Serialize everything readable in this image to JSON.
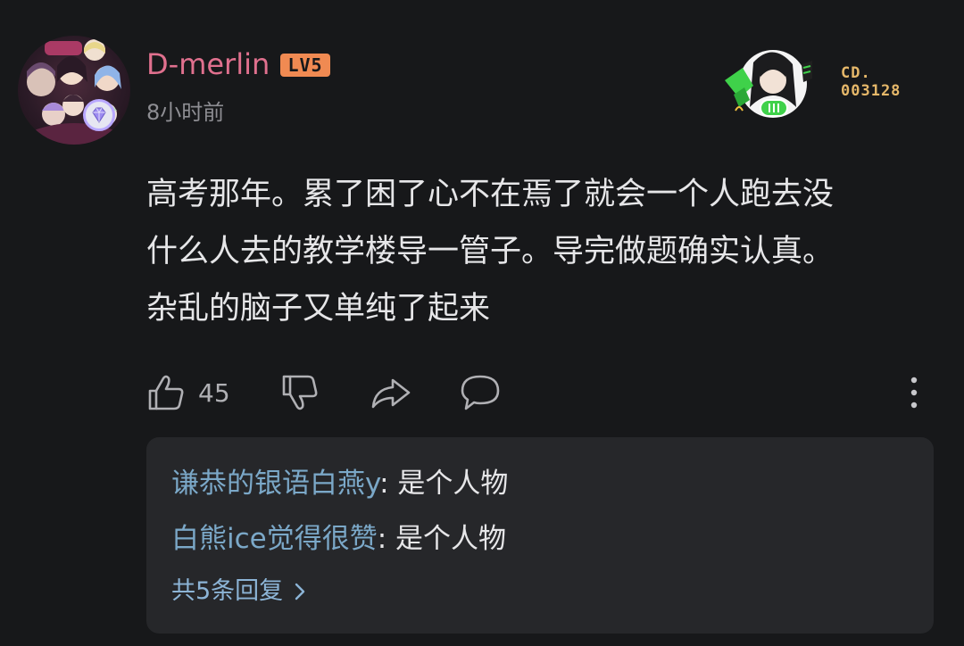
{
  "post": {
    "username": "D-merlin",
    "level": "LV5",
    "timestamp": "8小时前",
    "decor_code_line1": "CD.",
    "decor_code_line2": "003128",
    "body_line1": "高考那年。累了困了心不在焉了就会一个人跑去没",
    "body_line2": "什么人去的教学楼导一管子。导完做题确实认真。",
    "body_line3": "杂乱的脑子又单纯了起来",
    "like_count": "45"
  },
  "replies": {
    "items": [
      {
        "author": "谦恭的银语白燕y",
        "text": ": 是个人物"
      },
      {
        "author": "白熊ice觉得很赞",
        "text": ": 是个人物"
      }
    ],
    "more_label": "共5条回复"
  },
  "colors": {
    "background": "#17181a",
    "username": "#e0708e",
    "level_badge": "#f08a52",
    "reply_author": "#7ba8c8",
    "reply_panel": "#26272a"
  },
  "icons": {
    "like": "thumbs-up-icon",
    "dislike": "thumbs-down-icon",
    "share": "share-arrow-icon",
    "reply": "comment-bubble-icon",
    "more": "more-vertical-icon"
  }
}
